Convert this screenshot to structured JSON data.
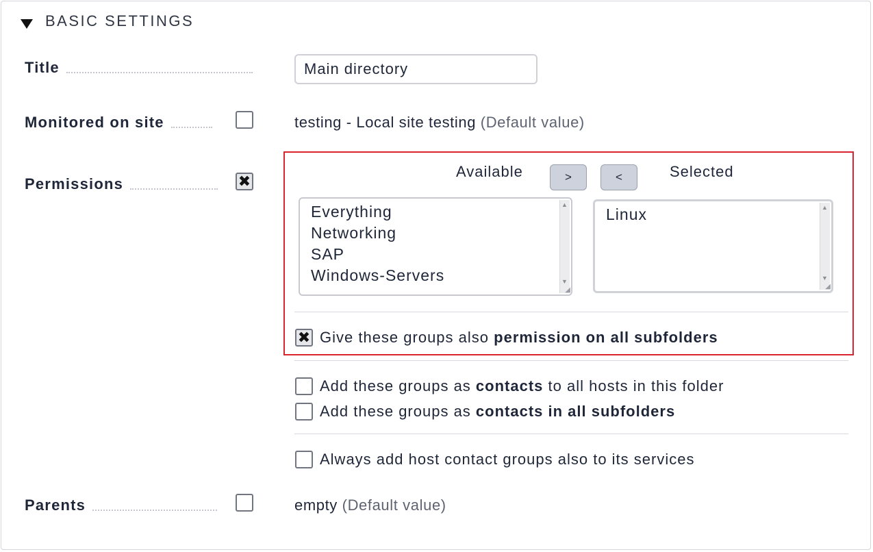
{
  "section": {
    "title": "BASIC SETTINGS"
  },
  "title_field": {
    "label": "Title",
    "value": "Main directory"
  },
  "monitored": {
    "label": "Monitored on site",
    "value": "testing - Local site testing",
    "default_note": "(Default value)"
  },
  "permissions": {
    "label": "Permissions",
    "available_label": "Available",
    "selected_label": "Selected",
    "add_button": ">",
    "remove_button": "<",
    "available_items": [
      "Everything",
      "Networking",
      "SAP",
      "Windows-Servers"
    ],
    "selected_items": [
      "Linux"
    ],
    "subfolders_option": {
      "prefix": "Give these groups also ",
      "bold": "permission on all subfolders",
      "checked": true
    }
  },
  "contacts": {
    "hosts_option": {
      "prefix": "Add these groups as ",
      "bold": "contacts",
      "suffix": " to all hosts in this folder"
    },
    "subfolders_option": {
      "prefix": "Add these groups as ",
      "bold": "contacts in all subfolders"
    },
    "services_option": {
      "text": "Always add host contact groups also to its services"
    }
  },
  "parents": {
    "label": "Parents",
    "value": "empty",
    "default_note": "(Default value)"
  },
  "colors": {
    "highlight_border": "#d9232e",
    "text": "#1e2638",
    "button_bg": "#ced2dc"
  }
}
